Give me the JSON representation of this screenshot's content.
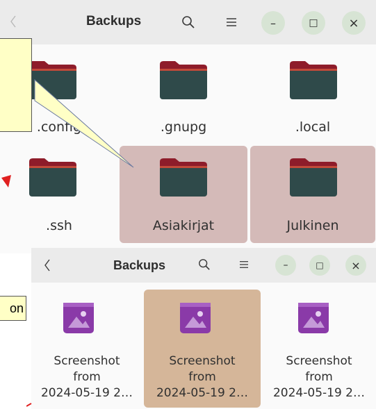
{
  "window1": {
    "title": "Backups",
    "back_icon": "chevron-left-icon",
    "search_icon": "search-icon",
    "menu_icon": "hamburger-menu-icon",
    "buttons": {
      "minimize": "–",
      "maximize": "□",
      "close": "×"
    },
    "items": [
      {
        "label": ".config",
        "selected": false
      },
      {
        "label": ".gnupg",
        "selected": false
      },
      {
        "label": ".local",
        "selected": false
      },
      {
        "label": ".ssh",
        "selected": false
      },
      {
        "label": "Asiakirjat",
        "selected": true
      },
      {
        "label": "Julkinen",
        "selected": true
      }
    ]
  },
  "window2": {
    "title": "Backups",
    "items": [
      {
        "line1": "Screenshot",
        "line2": "from",
        "line3": "2024-05-19 2…",
        "selected": false
      },
      {
        "line1": "Screenshot",
        "line2": "from",
        "line3": "2024-05-19 2…",
        "selected": true
      },
      {
        "line1": "Screenshot",
        "line2": "from",
        "line3": "2024-05-19 2…",
        "selected": false
      }
    ]
  },
  "callouts": {
    "second_text": "on"
  },
  "colors": {
    "folder_body": "#2f4a4a",
    "folder_tab": "#8e1c2a",
    "selection": "#d4bab8",
    "selection2": "#d5b699",
    "callout_fill": "#ffffc6",
    "image_icon": "#8a3aa8"
  }
}
